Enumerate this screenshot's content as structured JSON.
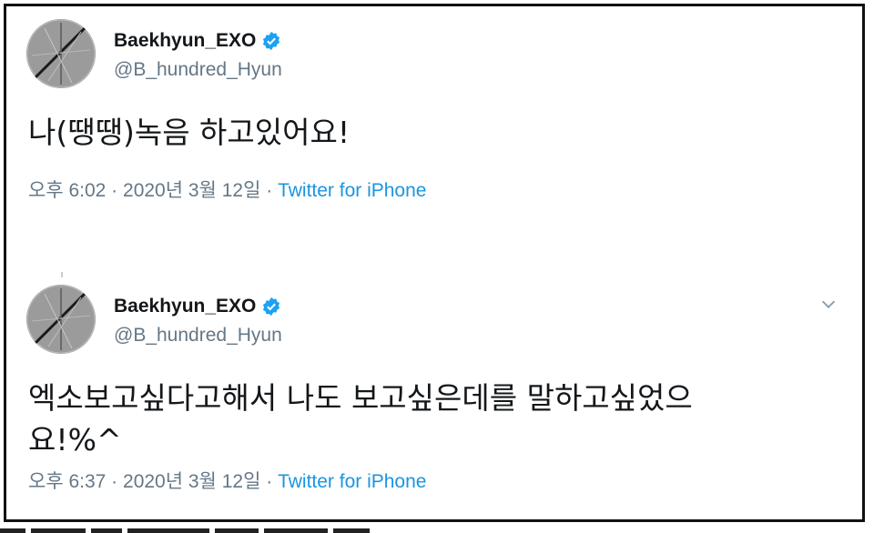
{
  "tweets": [
    {
      "name": "Baekhyun_EXO",
      "handle": "@B_hundred_Hyun",
      "text": "나(땡땡)녹음 하고있어요!",
      "time": "오후 6:02 · 2020년 3월 12일 · ",
      "source": "Twitter for iPhone"
    },
    {
      "name": "Baekhyun_EXO",
      "handle": "@B_hundred_Hyun",
      "text": "엑소보고싶다고해서 나도 보고싶은데를 말하고싶었으\n요!%^",
      "time": "오후 6:37 · 2020년 3월 12일 · ",
      "source": "Twitter for iPhone"
    }
  ],
  "colors": {
    "verified": "#1da1f2",
    "link": "#1b95e0",
    "muted": "#657786"
  }
}
